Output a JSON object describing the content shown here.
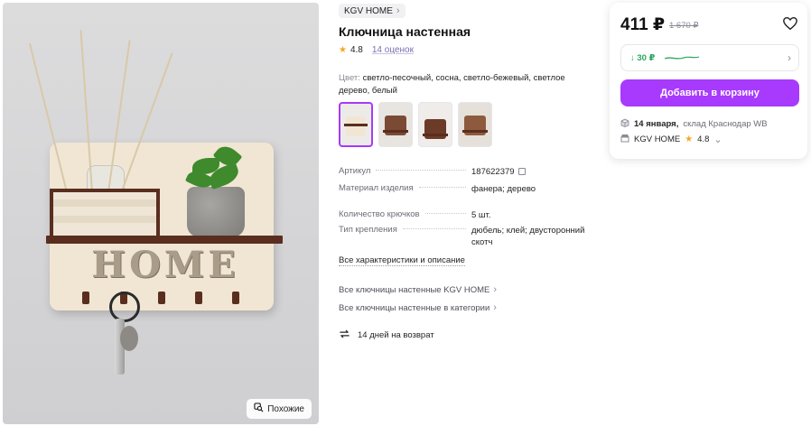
{
  "product": {
    "brand": "KGV HOME",
    "title": "Ключница настенная",
    "rating": "4.8",
    "reviews": "14 оценок",
    "color_label": "Цвет:",
    "color_value": "светло-песочный, сосна, светло-бежевый, светлое дерево, белый",
    "thumbnail_count": 4,
    "selected_thumbnail": 0
  },
  "image": {
    "sign_text": "HOME",
    "similar_button": "Похожие"
  },
  "specs": [
    {
      "key": "Артикул",
      "value": "187622379"
    },
    {
      "key": "Материал изделия",
      "value": "фанера; дерево"
    },
    {
      "key": "Количество крючков",
      "value": "5 шт."
    },
    {
      "key": "Тип крепления",
      "value": "дюбель; клей; двусторонний скотч"
    }
  ],
  "links": {
    "all_characteristics": "Все характеристики и описание",
    "brand_catalog": "Все ключницы настенные KGV HOME",
    "category_catalog": "Все ключницы настенные в категории"
  },
  "returns": "14 дней на возврат",
  "buy_card": {
    "price": "411 ₽",
    "old_price": "1 670 ₽",
    "wallet": "↓ 30 ₽",
    "add_to_cart": "Добавить в корзину",
    "delivery_date": "14 января,",
    "delivery_place": "склад Краснодар WB",
    "seller": "KGV HOME",
    "seller_rating": "4.8"
  },
  "colors": {
    "accent": "#a73afd",
    "wallet_green": "#2aa65c",
    "star": "#f5a623",
    "wood_dark": "#5a2e1f"
  }
}
